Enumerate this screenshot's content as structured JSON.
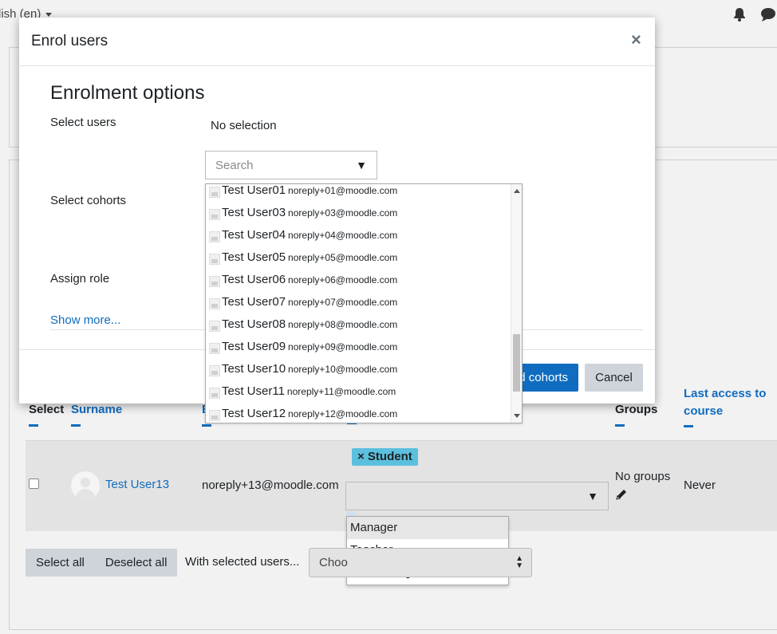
{
  "topbar": {
    "language": "lish (en)"
  },
  "modal": {
    "title": "Enrol users",
    "close_glyph": "×",
    "section_title": "Enrolment options",
    "select_users_label": "Select users",
    "select_users_value": "No selection",
    "search_placeholder": "Search",
    "select_cohorts_label": "Select cohorts",
    "assign_role_label": "Assign role",
    "show_more": "Show more...",
    "primary_button": "d cohorts",
    "cancel_button": "Cancel"
  },
  "suggestions": [
    {
      "name": "Test User01",
      "email": "noreply+01@moodle.com"
    },
    {
      "name": "Test User03",
      "email": "noreply+03@moodle.com"
    },
    {
      "name": "Test User04",
      "email": "noreply+04@moodle.com"
    },
    {
      "name": "Test User05",
      "email": "noreply+05@moodle.com"
    },
    {
      "name": "Test User06",
      "email": "noreply+06@moodle.com"
    },
    {
      "name": "Test User07",
      "email": "noreply+07@moodle.com"
    },
    {
      "name": "Test User08",
      "email": "noreply+08@moodle.com"
    },
    {
      "name": "Test User09",
      "email": "noreply+09@moodle.com"
    },
    {
      "name": "Test User10",
      "email": "noreply+10@moodle.com"
    },
    {
      "name": "Test User11",
      "email": "noreply+11@moodle.com"
    },
    {
      "name": "Test User12",
      "email": "noreply+12@moodle.com"
    }
  ],
  "table": {
    "headers": {
      "select": "Select",
      "surname": "Surname",
      "email_partial": "E",
      "groups": "Groups",
      "last_access_line1": "Last access to",
      "last_access_line2": "course"
    },
    "row": {
      "name": "Test User13",
      "email": "noreply+13@moodle.com",
      "role_badge": "× Student",
      "groups": "No groups",
      "last_access": "Never"
    }
  },
  "role_options": [
    "Manager",
    "Teacher",
    "Non-editing teacher"
  ],
  "bulk": {
    "select_all": "Select all",
    "deselect_all": "Deselect all",
    "with_selected": "With selected users...",
    "choose": "Choo"
  },
  "colors": {
    "link": "#0f6cbf",
    "badge": "#5bc0de",
    "button_secondary": "#ced4da"
  }
}
